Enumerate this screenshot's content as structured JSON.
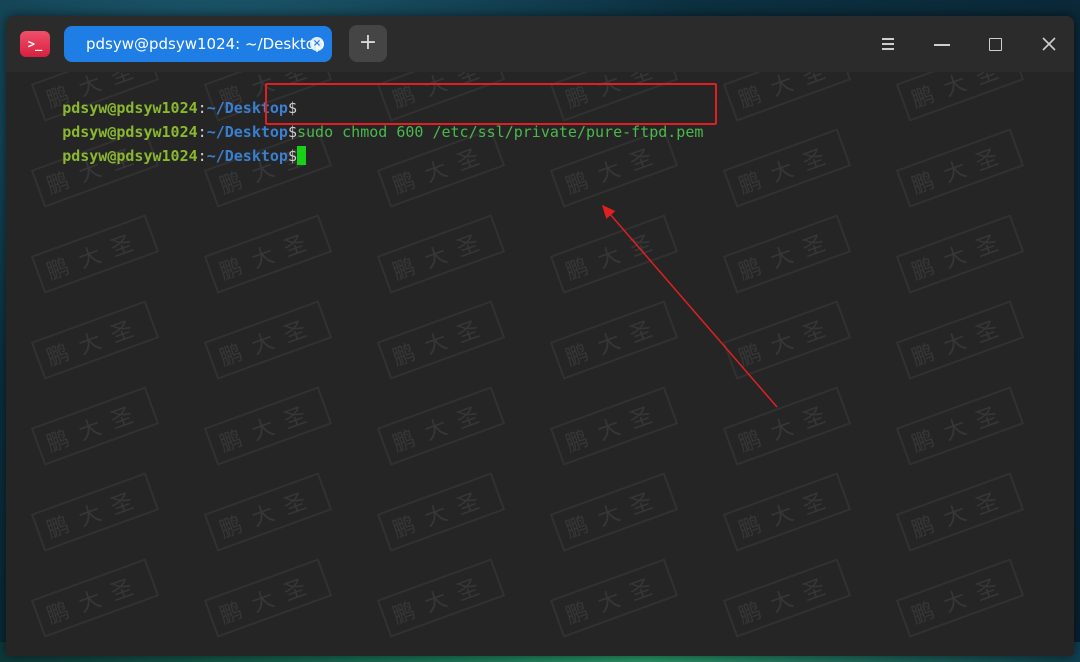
{
  "window": {
    "tab_title": "pdsyw@pdsyw1024: ~/Desktop",
    "new_tab_symbol": "+",
    "app_icon_symbol": ">_"
  },
  "terminal": {
    "lines": [
      {
        "user_host": "pdsyw@pdsyw1024",
        "colon": ":",
        "path": "~/Desktop",
        "dollar": "$",
        "command": ""
      },
      {
        "user_host": "pdsyw@pdsyw1024",
        "colon": ":",
        "path": "~/Desktop",
        "dollar": "$",
        "command": "sudo chmod 600 /etc/ssl/private/pure-ftpd.pem"
      },
      {
        "user_host": "pdsyw@pdsyw1024",
        "colon": ":",
        "path": "~/Desktop",
        "dollar": "$",
        "command": ""
      }
    ],
    "watermark_text": "鹏大圣"
  },
  "colors": {
    "tab_accent": "#1e7ee6",
    "prompt_user": "#8ab82e",
    "prompt_path": "#3a7fd0",
    "command": "#4bb84b",
    "cursor": "#19d019",
    "annotation": "#e02020"
  }
}
